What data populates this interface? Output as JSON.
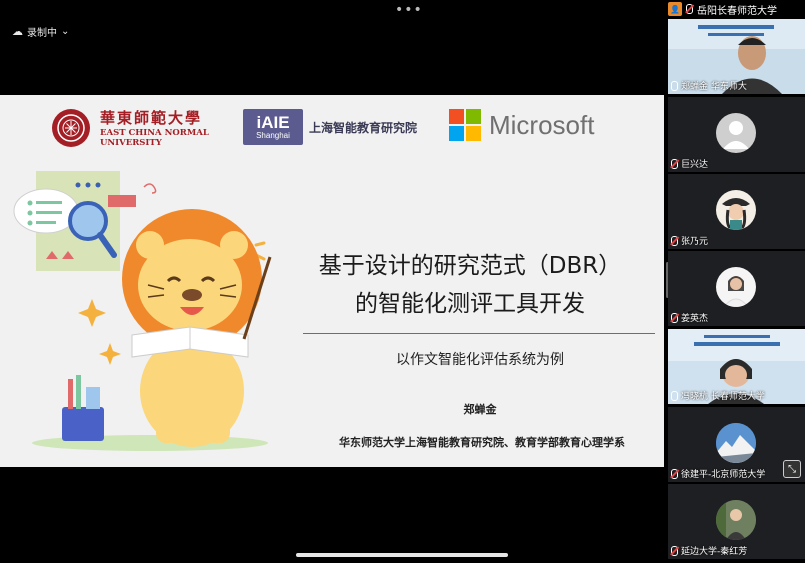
{
  "status": {
    "recording_label": "录制中",
    "recording_icon": "cloud-record-icon",
    "menu_icon": "more-dots-icon"
  },
  "slide": {
    "logos": {
      "ecnu_cn": "華東師範大學",
      "ecnu_en_1": "EAST CHINA NORMAL",
      "ecnu_en_2": "UNIVERSITY",
      "iaie_big": "iAIE",
      "iaie_small": "Shanghai",
      "iaie_name": "上海智能教育研究院",
      "microsoft": "Microsoft"
    },
    "title_line1": "基于设计的研究范式（DBR）",
    "title_line2": "的智能化测评工具开发",
    "subtitle": "以作文智能化评估系统为例",
    "author": "郑蝉金",
    "affiliation": "华东师范大学上海智能教育研究院、教育学部教育心理学系"
  },
  "participants": {
    "top_label": "岳阳长春师范大学",
    "tiles": [
      {
        "name": "郑蝉金 华东师大",
        "type": "video",
        "muted": false
      },
      {
        "name": "巨兴达",
        "type": "avatar-default",
        "muted": true
      },
      {
        "name": "张乃元",
        "type": "avatar-photo",
        "muted": true
      },
      {
        "name": "姜英杰",
        "type": "avatar-photo",
        "muted": true
      },
      {
        "name": "冯晓杭 长春师范大学",
        "type": "video",
        "muted": false,
        "active": true
      },
      {
        "name": "徐建平-北京师范大学",
        "type": "avatar-photo",
        "muted": true
      },
      {
        "name": "延边大学-秦红芳",
        "type": "avatar-photo",
        "muted": true
      }
    ]
  },
  "colors": {
    "ecnu_red": "#a41f25",
    "active_border": "#36c25c",
    "ms_red": "#f25022",
    "ms_green": "#7fba00",
    "ms_blue": "#00a4ef",
    "ms_yellow": "#ffb900"
  }
}
